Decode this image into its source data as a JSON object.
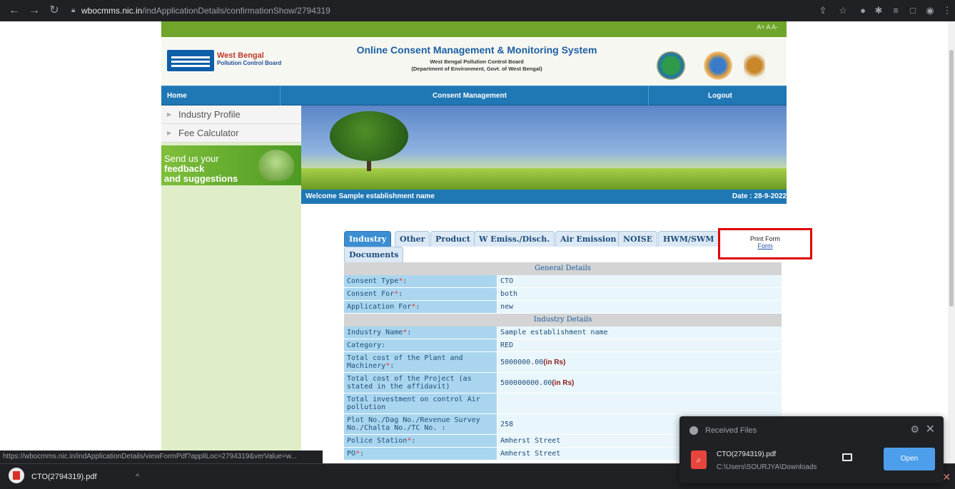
{
  "browser": {
    "url_host": "wbocmms.nic.in",
    "url_path": "/indApplicationDetails/confirmationShow/2794319",
    "icons": [
      "back-icon",
      "forward-icon",
      "reload-icon",
      "lock-icon",
      "share-icon",
      "star-icon",
      "shield-icon",
      "extensions-icon",
      "reading-list-icon",
      "side-panel-icon",
      "profile-icon",
      "menu-icon"
    ],
    "status_url": "https://wbocmms.nic.in/indApplicationDetails/viewFormPdf?appliLoc=2794319&verValue=w..."
  },
  "site": {
    "font_controls": "A+ A A-",
    "logo_line1": "West Bengal",
    "logo_line2": "Pollution Control Board",
    "title": "Online Consent Management & Monitoring System",
    "subtitle1": "West Bengal Pollution Control Board",
    "subtitle2": "(Department of Environment, Govt. of West Bengal)"
  },
  "menu": {
    "home": "Home",
    "consent": "Consent Management",
    "logout": "Logout"
  },
  "sidebar": {
    "items": [
      {
        "label": "Industry Profile"
      },
      {
        "label": "Fee Calculator"
      }
    ],
    "feedback_line1": "Send us your",
    "feedback_bold1": "feedback",
    "feedback_line2": "and suggestions"
  },
  "welcome": {
    "text": "Welcome Sample establishment name",
    "date": "Date : 28-9-2022"
  },
  "tabs": [
    {
      "label": "Industry",
      "active": true
    },
    {
      "label": "Other"
    },
    {
      "label": "Product"
    },
    {
      "label": "W Emiss./Disch."
    },
    {
      "label": "Air Emission"
    },
    {
      "label": "NOISE"
    },
    {
      "label": "HWM/SWM"
    },
    {
      "label": "Documents"
    }
  ],
  "print_form": {
    "label": "Print Form",
    "link": "Form"
  },
  "details": {
    "general_header": "General Details",
    "consent_type_label": "Consent Type",
    "consent_type_value": "CTO",
    "consent_for_label": "Consent For",
    "consent_for_value": "both",
    "application_for_label": "Application For",
    "application_for_value": "new",
    "industry_header": "Industry Details",
    "industry_name_label": "Industry Name",
    "industry_name_value": "Sample establishment name",
    "category_label": "Category:",
    "category_value": "RED",
    "plant_cost_label": "Total cost of the Plant and Machinery",
    "plant_cost_value": "5000000.00",
    "project_cost_label": "Total cost of the Project (as stated in the affidavit)",
    "project_cost_value": "500000000.00",
    "unit": "(in Rs)",
    "investment_label": "Total investment on control Air pollution",
    "plot_label": "Plot No./Dag No./Revenue Survey No./Chalta No./TC No. :",
    "plot_value": "258",
    "police_label": "Police Station",
    "police_value": "Amherst Street",
    "po_label": "PO",
    "po_value": "Amherst Street",
    "required_mark": "*",
    "colon": ":"
  },
  "downloads": {
    "file": "CTO(2794319).pdf",
    "caret": "^",
    "close": "✕"
  },
  "toast": {
    "title": "Received Files",
    "file_name": "CTO(2794319).pdf",
    "file_path": "C:\\Users\\SOURJYA\\Downloads",
    "open_label": "Open"
  }
}
